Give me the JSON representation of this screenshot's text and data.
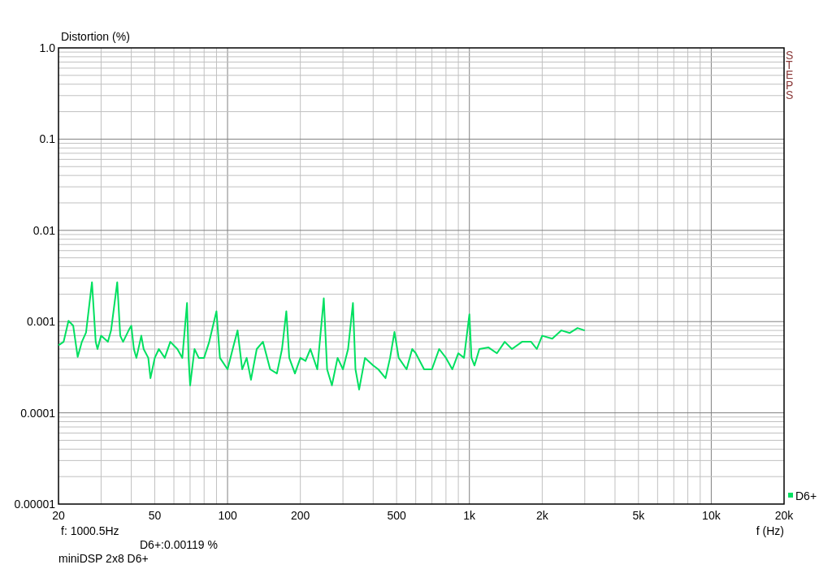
{
  "chart": {
    "logo_text": "STEPS",
    "y_axis_title": "Distortion (%)",
    "x_axis_title": "f (Hz)",
    "y_axis_labels": [
      "1.0",
      "0.1",
      "0.01",
      "0.001",
      "0.0001",
      "0.00001"
    ],
    "x_axis_labels": [
      "20",
      "50",
      "100",
      "200",
      "500",
      "1k",
      "2k",
      "5k",
      "10k",
      "20k"
    ],
    "legend": [
      {
        "name": "D6+",
        "color": "#00e060"
      }
    ]
  },
  "cursor": {
    "frequency": "f: 1000.5Hz",
    "reading": "D6+:0.00119 %"
  },
  "caption": "miniDSP 2x8 D6+"
}
